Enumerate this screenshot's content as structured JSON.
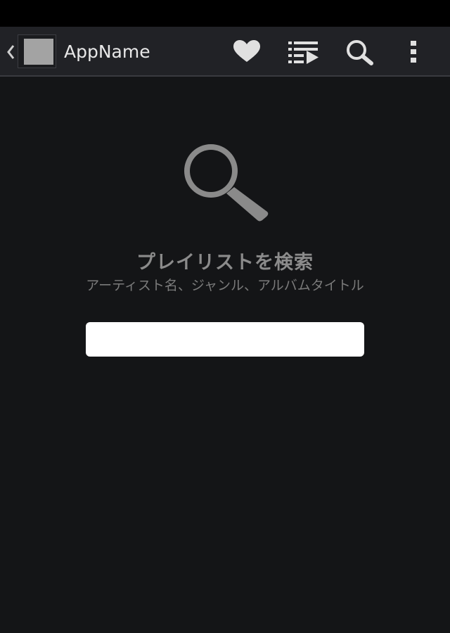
{
  "action_bar": {
    "app_name": "AppName",
    "icons": [
      "back-chevron-icon",
      "app-icon",
      "heart-icon",
      "playlist-play-icon",
      "search-icon",
      "overflow-menu-icon"
    ]
  },
  "search_prompt": {
    "title": "プレイリストを検索",
    "subtitle": "アーティスト名、ジャンル、アルバムタイトル",
    "input_value": "",
    "input_placeholder": ""
  },
  "colors": {
    "status_bar": "#000000",
    "action_bar": "#212226",
    "background": "#141517",
    "icon_light": "#e0e0e0",
    "hero_icon": "#8a8a8a",
    "input_background": "#ffffff"
  }
}
